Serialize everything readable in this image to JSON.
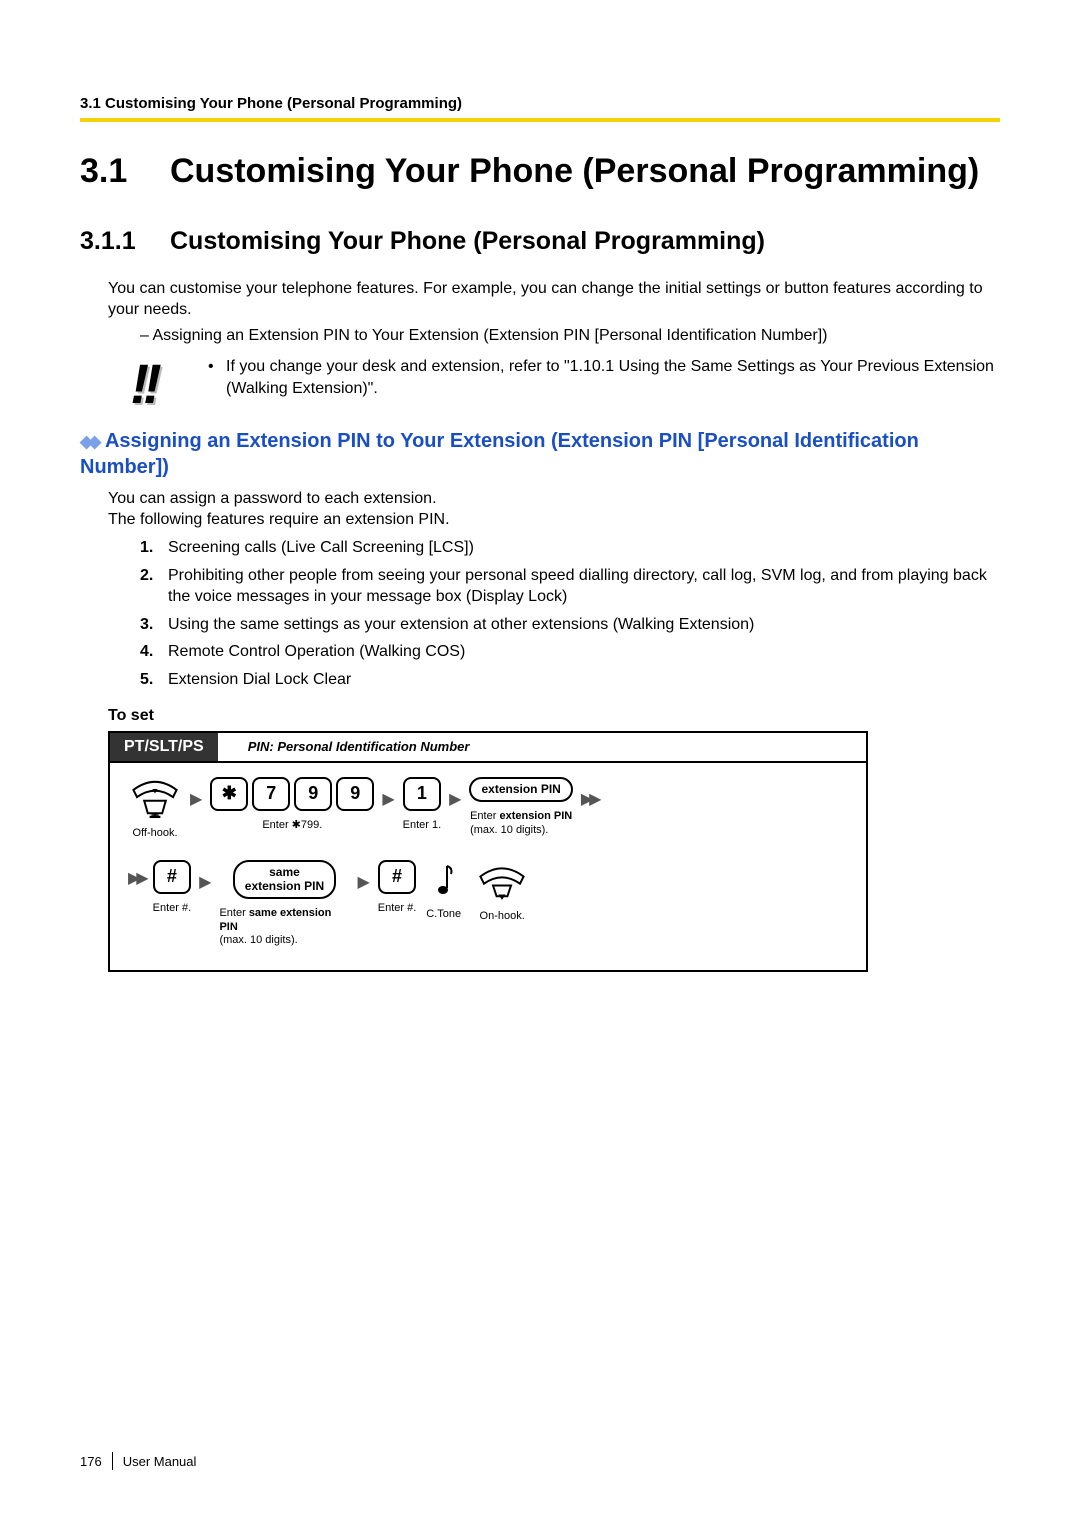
{
  "header": {
    "running": "3.1 Customising Your Phone (Personal Programming)"
  },
  "h1": {
    "num": "3.1",
    "text": "Customising Your Phone (Personal Programming)"
  },
  "h2": {
    "num": "3.1.1",
    "text": "Customising Your Phone (Personal Programming)"
  },
  "intro": "You can customise your telephone features. For example, you can change the initial settings or button features according to your needs.",
  "dash_item": "–   Assigning an Extension PIN to Your Extension (Extension PIN [Personal Identification Number])",
  "note_bullet": "If you change your desk and extension, refer to \"1.10.1 Using the Same Settings as Your Previous Extension (Walking Extension)\".",
  "blue_heading": "Assigning an Extension PIN to Your Extension (Extension PIN [Personal Identification Number])",
  "desc1": "You can assign a password to each extension.",
  "desc2": "The following features require an extension PIN.",
  "list": [
    "Screening calls (Live Call Screening [LCS])",
    "Prohibiting other people from seeing your personal speed dialling directory, call log, SVM log, and from playing back the voice messages in your message box (Display Lock)",
    "Using the same settings as your extension at other extensions (Walking Extension)",
    "Remote Control Operation (Walking COS)",
    "Extension Dial Lock Clear"
  ],
  "op_title": "To set",
  "proc": {
    "tab": "PT/SLT/PS",
    "header_note": "PIN: Personal Identification Number",
    "row1": {
      "offhook_caption": "Off-hook.",
      "keys": [
        "✱",
        "7",
        "9",
        "9"
      ],
      "enter799": "Enter ✱799.",
      "key1": "1",
      "enter1": "Enter 1.",
      "ext_pin_label": "extension PIN",
      "ext_pin_caption_a": "Enter ",
      "ext_pin_caption_b": "extension PIN",
      "ext_pin_caption_c": " (max. 10 digits)."
    },
    "row2": {
      "hash1": "#",
      "enter_hash1": "Enter #.",
      "same_pin_label_a": "same",
      "same_pin_label_b": "extension PIN",
      "same_caption_a": "Enter ",
      "same_caption_b": "same extension PIN",
      "same_caption_c": " (max. 10 digits).",
      "hash2": "#",
      "enter_hash2": "Enter #.",
      "ctone": "C.Tone",
      "onhook": "On-hook."
    }
  },
  "footer": {
    "page": "176",
    "label": "User Manual"
  }
}
